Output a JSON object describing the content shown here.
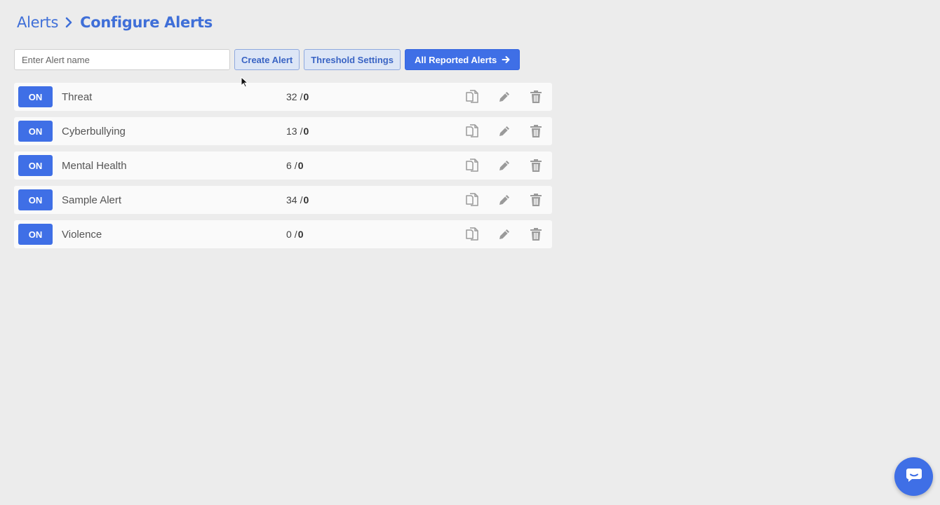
{
  "breadcrumb": {
    "root": "Alerts",
    "current": "Configure Alerts"
  },
  "toolbar": {
    "search_placeholder": "Enter Alert name",
    "create_label": "Create Alert",
    "threshold_label": "Threshold Settings",
    "reported_label": "All Reported Alerts"
  },
  "alerts": [
    {
      "toggle": "ON",
      "name": "Threat",
      "count": "32",
      "total": "0"
    },
    {
      "toggle": "ON",
      "name": "Cyberbullying",
      "count": "13",
      "total": "0"
    },
    {
      "toggle": "ON",
      "name": "Mental Health",
      "count": "6",
      "total": "0"
    },
    {
      "toggle": "ON",
      "name": "Sample Alert",
      "count": "34",
      "total": "0"
    },
    {
      "toggle": "ON",
      "name": "Violence",
      "count": "0",
      "total": "0"
    }
  ],
  "count_separator": "/",
  "colors": {
    "accent": "#3f6fe6",
    "breadcrumb": "#3f6fd8",
    "background": "#ececec",
    "icon_gray": "#9a9a9a"
  },
  "icons": {
    "breadcrumb_separator": "chevron-right-icon",
    "reported_arrow": "arrow-right-icon",
    "row_actions": [
      "copy-icon",
      "pencil-icon",
      "trash-icon"
    ],
    "chat": "chat-icon"
  }
}
